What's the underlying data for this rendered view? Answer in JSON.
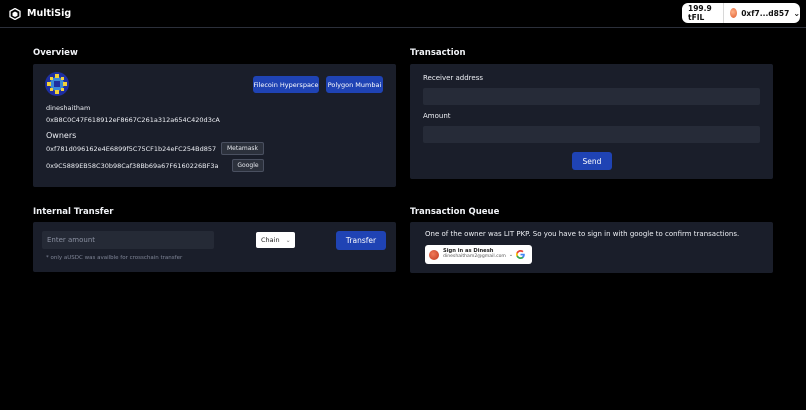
{
  "app": {
    "title": "MultiSig"
  },
  "wallet": {
    "balance": "199.9 tFIL",
    "address": "0xf7...d857"
  },
  "overview": {
    "title": "Overview",
    "networks": [
      "Filecoin Hyperspace",
      "Polygon Mumbai"
    ],
    "name": "dineshaitham",
    "address": "0xB8C0C47F618912eF8667C261a312a654C420d3cA",
    "owners_label": "Owners",
    "owners": [
      {
        "address": "0xf781d096162e4E6899f5C75CF1b24eFC254Bd857",
        "source": "Metamask"
      },
      {
        "address": "0x9C5889EB58C30b98Caf38Bb69a67F6160226BF3a",
        "source": "Google"
      }
    ]
  },
  "transaction": {
    "title": "Transaction",
    "receiver_label": "Receiver address",
    "receiver_value": "",
    "amount_label": "Amount",
    "amount_value": "",
    "send_label": "Send"
  },
  "internal_transfer": {
    "title": "Internal Transfer",
    "amount_placeholder": "Enter amount",
    "chain_selected": "Chain",
    "transfer_label": "Transfer",
    "note": "* only aUSDC was availble for crosschain transfer"
  },
  "queue": {
    "title": "Transaction Queue",
    "message": "One of the owner was LIT PKP. So you have to sign in with google to confirm transactions.",
    "google_signin_line1": "Sign in as Dinesh",
    "google_signin_line2": "dineshaitham2@gmail.com"
  },
  "icons": {
    "brand": "shield-hex-icon",
    "wallet_chevron": "chevron-down-icon",
    "chain_chevron": "chevron-down-icon",
    "google": "google-g-icon"
  },
  "colors": {
    "background": "#000000",
    "panel": "#1a1e2a",
    "primary": "#1f43b4",
    "input": "#262b38"
  }
}
